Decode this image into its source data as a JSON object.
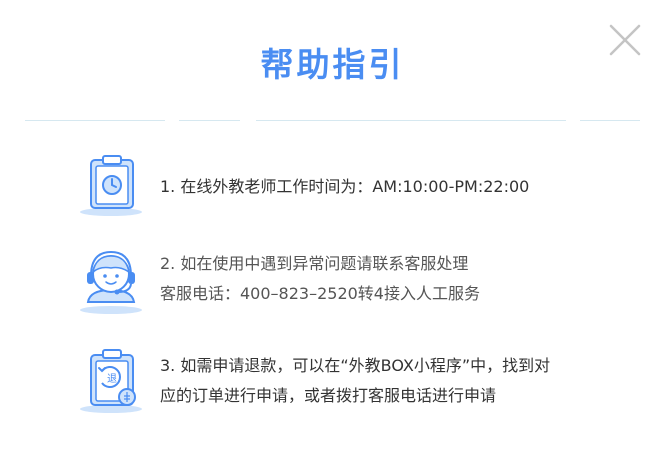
{
  "dialog": {
    "title": "帮助指引",
    "close_icon": "close-icon"
  },
  "items": [
    {
      "icon": "clipboard-clock-icon",
      "lines": [
        "1. 在线外教老师工作时间为：AM:10:00-PM:22:00"
      ]
    },
    {
      "icon": "customer-service-headset-icon",
      "lines": [
        "2. 如在使用中遇到异常问题请联系客服处理",
        "客服电话：400–823–2520转4接入人工服务"
      ]
    },
    {
      "icon": "clipboard-refund-icon",
      "lines": [
        "3. 如需申请退款，可以在“外教BOX小程序”中，找到对",
        "应的订单进行申请，或者拨打客服电话进行申请"
      ]
    }
  ],
  "colors": {
    "accent": "#4a8df2",
    "icon_fill": "#cfe3fb",
    "divider": "#d6e8f0",
    "close": "#c4c4c4"
  }
}
